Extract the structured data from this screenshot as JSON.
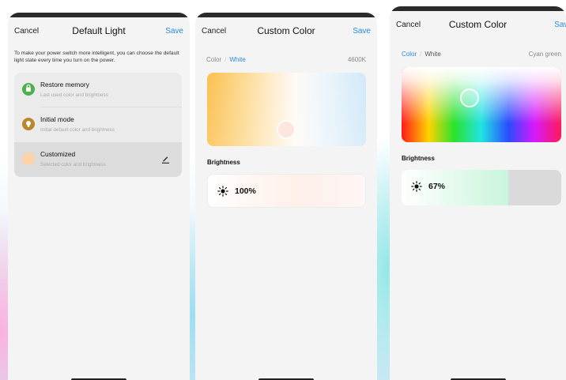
{
  "screens": [
    {
      "nav": {
        "cancel": "Cancel",
        "title": "Default Light",
        "save": "Save"
      },
      "description": "To make your power switch more intelligent, you can choose the default light state every time you turn on the power.",
      "options": [
        {
          "title": "Restore memory",
          "subtitle": "Last used color and brightness",
          "icon": "memory-icon",
          "color": "#4caf50"
        },
        {
          "title": "Initial mode",
          "subtitle": "Initial default color and brightness",
          "icon": "bulb-icon",
          "color": "#b8862b"
        },
        {
          "title": "Customized",
          "subtitle": "Selected color and brightness",
          "icon": "color-swatch",
          "color": "#fdd3a8",
          "selected": true
        }
      ]
    },
    {
      "nav": {
        "cancel": "Cancel",
        "title": "Custom Color",
        "save": "Save"
      },
      "tabs": {
        "color": "Color",
        "separator": "/",
        "white": "White",
        "active": "White"
      },
      "value_label": "4600K",
      "brightness": {
        "label": "Brightness",
        "value": "100%",
        "level": 100
      }
    },
    {
      "nav": {
        "cancel": "Cancel",
        "title": "Custom Color",
        "save": "Save"
      },
      "tabs": {
        "color": "Color",
        "separator": "/",
        "white": "White",
        "active": "Color"
      },
      "value_label": "Cyan green",
      "brightness": {
        "label": "Brightness",
        "value": "67%",
        "level": 67
      }
    }
  ],
  "colors": {
    "accent": "#2a8ae0",
    "panel": "#f4f4f4",
    "card": "#ebebeb"
  }
}
